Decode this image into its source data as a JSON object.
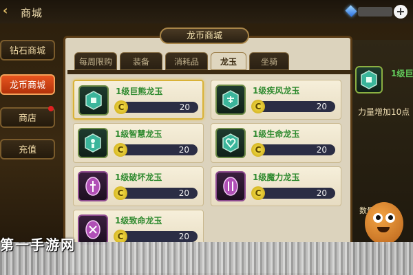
{
  "header": {
    "title": "商城",
    "back_icon": "chevron-left-icon",
    "currency_icon": "blue-gem-icon",
    "add_icon": "plus-icon"
  },
  "sidebar": {
    "items": [
      {
        "label": "钻石商城",
        "active": false
      },
      {
        "label": "龙币商城",
        "active": true
      },
      {
        "label": "商店",
        "active": false,
        "has_alert": true
      },
      {
        "label": "充值",
        "active": false
      }
    ]
  },
  "panel": {
    "title": "龙币商城",
    "tabs": [
      {
        "label": "每周限购",
        "active": false
      },
      {
        "label": "装备",
        "active": false
      },
      {
        "label": "消耗品",
        "active": false
      },
      {
        "label": "龙玉",
        "active": true
      },
      {
        "label": "坐骑",
        "active": false
      }
    ]
  },
  "items": [
    {
      "name": "1级巨熊龙玉",
      "price": "20",
      "icon": "bear-jade-icon",
      "selected": true
    },
    {
      "name": "1级疾风龙玉",
      "price": "20",
      "icon": "wind-jade-icon"
    },
    {
      "name": "1级智慧龙玉",
      "price": "20",
      "icon": "wisdom-jade-icon"
    },
    {
      "name": "1级生命龙玉",
      "price": "20",
      "icon": "heart-jade-icon"
    },
    {
      "name": "1级破坏龙玉",
      "price": "20",
      "icon": "destruction-jade-icon"
    },
    {
      "name": "1级魔力龙玉",
      "price": "20",
      "icon": "magic-jade-icon"
    },
    {
      "name": "1级致命龙玉",
      "price": "20",
      "icon": "lethal-jade-icon"
    }
  ],
  "detail": {
    "name": "1级巨",
    "description": "力量增加10点",
    "more_label": "数量",
    "icon": "bear-jade-icon"
  },
  "coin_symbol": "C",
  "watermark": "第一手游网",
  "colors": {
    "accent_active": "#e8551f",
    "item_name": "#2f8a2f",
    "price_coin": "#f8e24d"
  }
}
